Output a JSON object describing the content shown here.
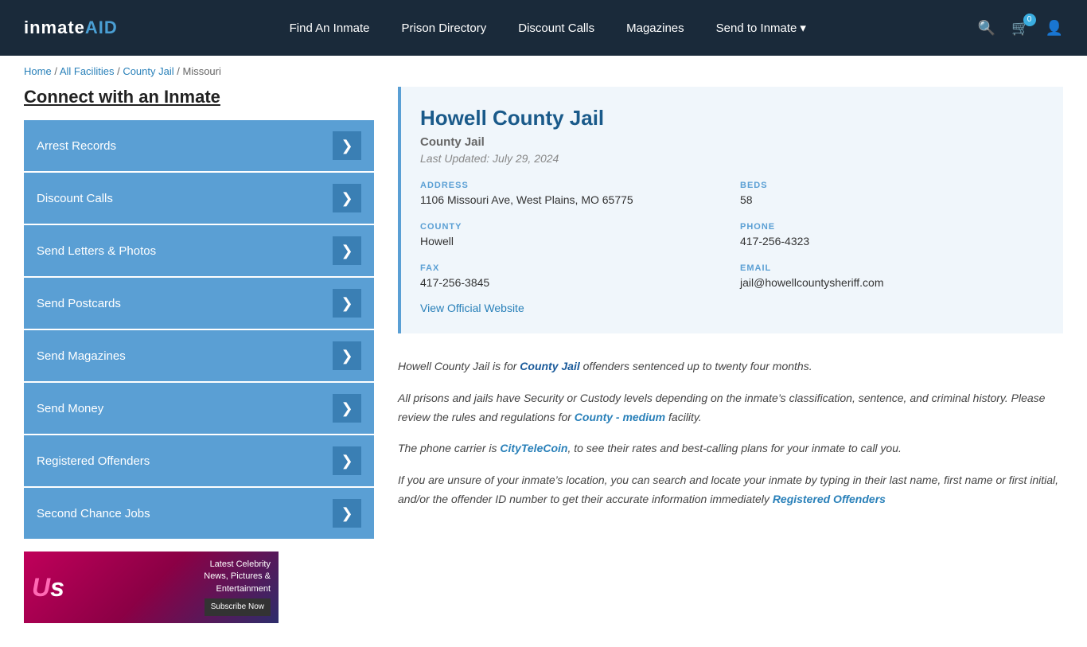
{
  "header": {
    "logo": "inmateAID",
    "logo_icon": "★",
    "nav": {
      "find_inmate": "Find An Inmate",
      "prison_directory": "Prison Directory",
      "discount_calls": "Discount Calls",
      "magazines": "Magazines",
      "send_to_inmate": "Send to Inmate",
      "send_to_inmate_arrow": "▾"
    },
    "cart_count": "0",
    "icons": {
      "search": "🔍",
      "cart": "🛒",
      "user": "👤"
    }
  },
  "breadcrumb": {
    "home": "Home",
    "all_facilities": "All Facilities",
    "county_jail": "County Jail",
    "state": "Missouri",
    "separator": "/"
  },
  "sidebar": {
    "title": "Connect with an Inmate",
    "items": [
      {
        "label": "Arrest Records",
        "arrow": "❯"
      },
      {
        "label": "Discount Calls",
        "arrow": "❯"
      },
      {
        "label": "Send Letters & Photos",
        "arrow": "❯"
      },
      {
        "label": "Send Postcards",
        "arrow": "❯"
      },
      {
        "label": "Send Magazines",
        "arrow": "❯"
      },
      {
        "label": "Send Money",
        "arrow": "❯"
      },
      {
        "label": "Registered Offenders",
        "arrow": "❯"
      },
      {
        "label": "Second Chance Jobs",
        "arrow": "❯"
      }
    ],
    "ad": {
      "logo": "Us",
      "tagline": "Latest Celebrity",
      "tagline2": "News, Pictures &",
      "tagline3": "Entertainment",
      "cta": "Subscribe Now"
    }
  },
  "facility": {
    "name": "Howell County Jail",
    "type": "County Jail",
    "last_updated": "Last Updated: July 29, 2024",
    "address_label": "ADDRESS",
    "address_value": "1106 Missouri Ave, West Plains, MO 65775",
    "beds_label": "BEDS",
    "beds_value": "58",
    "county_label": "COUNTY",
    "county_value": "Howell",
    "phone_label": "PHONE",
    "phone_value": "417-256-4323",
    "fax_label": "FAX",
    "fax_value": "417-256-3845",
    "email_label": "EMAIL",
    "email_value": "jail@howellcountysheriff.com",
    "website_link": "View Official Website"
  },
  "description": {
    "para1_pre": "Howell County Jail is for ",
    "para1_highlight": "County Jail",
    "para1_post": " offenders sentenced up to twenty four months.",
    "para2": "All prisons and jails have Security or Custody levels depending on the inmate’s classification, sentence, and criminal history. Please review the rules and regulations for ",
    "para2_highlight": "County - medium",
    "para2_post": " facility.",
    "para3_pre": "The phone carrier is ",
    "para3_highlight": "CityTeleCoin",
    "para3_post": ", to see their rates and best-calling plans for your inmate to call you.",
    "para4": "If you are unsure of your inmate’s location, you can search and locate your inmate by typing in their last name, first name or first initial, and/or the offender ID number to get their accurate information immediately ",
    "para4_highlight": "Registered Offenders"
  }
}
